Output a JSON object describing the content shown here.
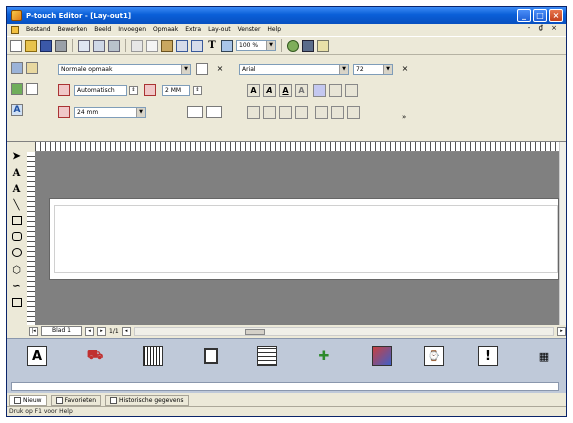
{
  "window": {
    "title": "P-touch Editor - [Lay-out1]",
    "title_buttons": {
      "minimize": "_",
      "maximize": "□",
      "close": "×"
    }
  },
  "menubar": {
    "items": [
      "Bestand",
      "Bewerken",
      "Beeld",
      "Invoegen",
      "Opmaak",
      "Extra",
      "Lay-out",
      "Venster",
      "Help"
    ],
    "window_controls": "- ₫ ×"
  },
  "toolbar": {
    "text_tool": "T",
    "zoom": "100 %"
  },
  "props": {
    "media": "Normale opmaak",
    "length_mode": "Automatisch",
    "length_value": "2 MM",
    "tape_width": "24 mm",
    "font": "Arial",
    "font_size": "72",
    "format_buttons": [
      "A",
      "A",
      "A",
      "A"
    ]
  },
  "tools": {
    "items": [
      "arrow",
      "text",
      "vertical-text",
      "line",
      "rectangle",
      "rounded-rectangle",
      "ellipse",
      "polygon",
      "freehand",
      "frame"
    ]
  },
  "sheetbar": {
    "sheet_name": "Blad 1",
    "page": "1/1"
  },
  "gallery": {
    "items": [
      "text-tool",
      "image-tool",
      "barcode-tool",
      "frame-tool",
      "table-tool",
      "clipart-tool",
      "image-insert-tool",
      "date-tool",
      "symbol-tool",
      "calendar-tool"
    ]
  },
  "bottom_tabs": [
    {
      "label": "Nieuw",
      "active": true
    },
    {
      "label": "Favorieten",
      "active": false
    },
    {
      "label": "Historische gegevens",
      "active": false
    }
  ],
  "status": {
    "text": "Druk op F1 voor Help"
  },
  "colors": {
    "titlebar": "#0a5fd8",
    "gallery_bg": "#bfc9d9",
    "canvas_bg": "#808080"
  }
}
